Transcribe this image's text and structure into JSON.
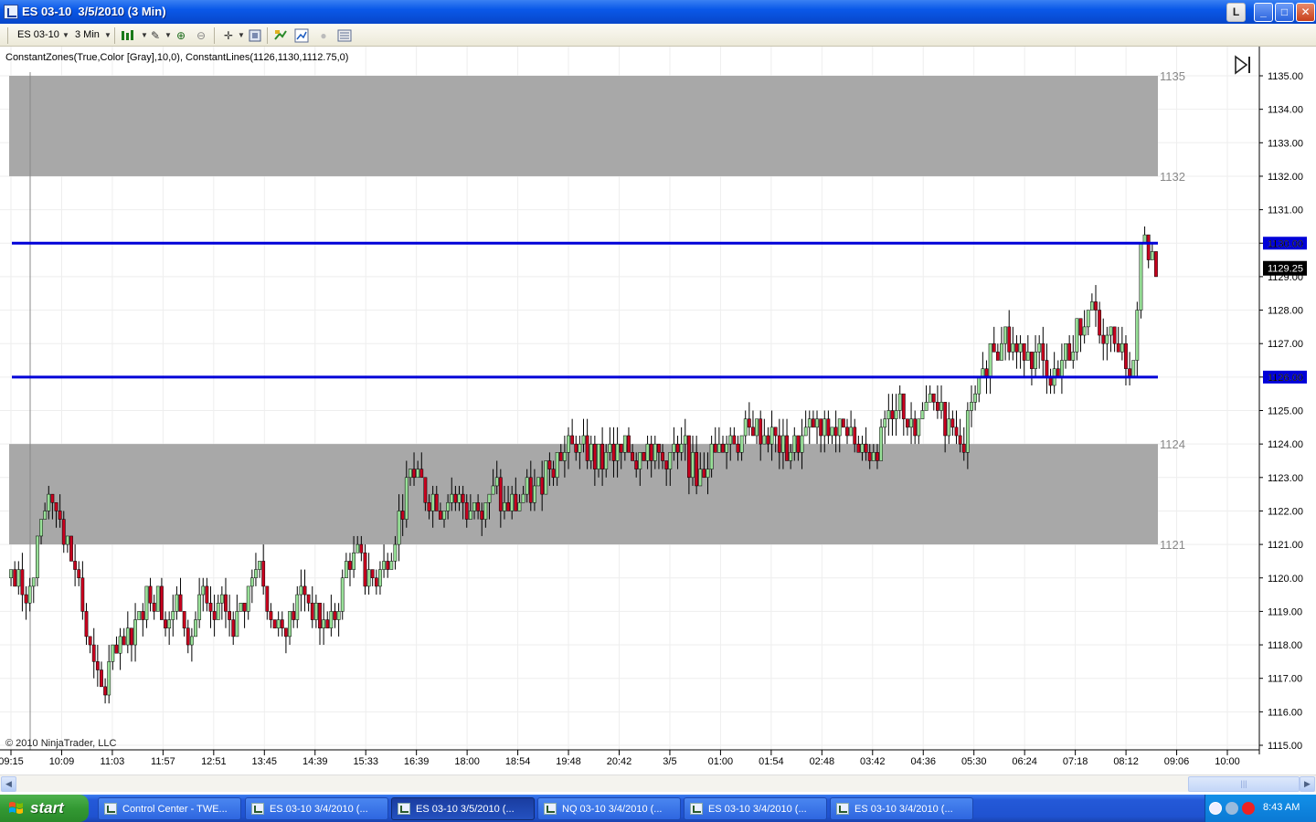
{
  "window": {
    "title": "ES 03-10  3/5/2010 (3 Min)",
    "buttons": {
      "l": "L",
      "minimize": "_",
      "maximize": "□",
      "close": "✕"
    }
  },
  "toolbar": {
    "instrument": "ES 03-10",
    "interval": "3 Min",
    "icons": [
      "dropdown-arrow-icon",
      "bar-chart-type-icon",
      "pencil-draw-icon",
      "zoom-in-icon",
      "zoom-out-icon",
      "crosshair-icon",
      "properties-icon",
      "strategy-icon",
      "indicator-icon",
      "globe-icon",
      "data-box-icon"
    ]
  },
  "chart": {
    "indicator_label": "ConstantZones(True,Color [Gray],10,0), ConstantLines(1126,1130,1112.75,0)",
    "copyright": "© 2010 NinjaTrader, LLC",
    "colors": {
      "up": "#98e098",
      "down": "#c8001e",
      "zone": "#a8a8a8",
      "line": "#0000d8"
    },
    "zones": [
      {
        "top": 1135,
        "bottom": 1132,
        "top_label": "1135",
        "bottom_label": "1132"
      },
      {
        "top": 1124,
        "bottom": 1121,
        "top_label": "1124",
        "bottom_label": "1121"
      }
    ],
    "lines": [
      {
        "value": 1130,
        "label": "1130.00"
      },
      {
        "value": 1126,
        "label": "1126.00"
      }
    ],
    "last_price": {
      "value": 1129.25,
      "label": "1129.25"
    },
    "y_axis_ticks": [
      "1135.00",
      "1134.00",
      "1133.00",
      "1132.00",
      "1131.00",
      "1130.00",
      "1129.00",
      "1128.00",
      "1127.00",
      "1126.00",
      "1125.00",
      "1124.00",
      "1123.00",
      "1122.00",
      "1121.00",
      "1120.00",
      "1119.00",
      "1118.00",
      "1117.00",
      "1116.00",
      "1115.00"
    ],
    "x_axis_ticks": [
      "09:15",
      "10:09",
      "11:03",
      "11:57",
      "12:51",
      "13:45",
      "14:39",
      "15:33",
      "16:39",
      "18:00",
      "18:54",
      "19:48",
      "20:42",
      "3/5",
      "01:00",
      "01:54",
      "02:48",
      "03:42",
      "04:36",
      "05:30",
      "06:24",
      "07:18",
      "08:12",
      "09:06",
      "10:00"
    ]
  },
  "chart_data": {
    "type": "candlestick",
    "title": "ES 03-10  3/5/2010 (3 Min)",
    "y_range": [
      1115,
      1135
    ],
    "x_ticks": [
      "09:15",
      "10:09",
      "11:03",
      "11:57",
      "12:51",
      "13:45",
      "14:39",
      "15:33",
      "16:39",
      "18:00",
      "18:54",
      "19:48",
      "20:42",
      "3/5",
      "01:00",
      "01:54",
      "02:48",
      "03:42",
      "04:36",
      "05:30",
      "06:24",
      "07:18",
      "08:12",
      "09:06",
      "10:00"
    ],
    "path": [
      [
        0,
        1120
      ],
      [
        3,
        1119.75
      ],
      [
        6,
        1120
      ],
      [
        9,
        1121.5
      ],
      [
        12,
        1122.75
      ],
      [
        15,
        1121
      ],
      [
        18,
        1120.25
      ],
      [
        21,
        1118
      ],
      [
        24,
        1116.5
      ],
      [
        27,
        1117.5
      ],
      [
        30,
        1117.75
      ],
      [
        33,
        1118.5
      ],
      [
        36,
        1119.5
      ],
      [
        39,
        1119.75
      ],
      [
        42,
        1118.75
      ],
      [
        45,
        1119.5
      ],
      [
        48,
        1118.25
      ],
      [
        51,
        1119.25
      ],
      [
        54,
        1118.75
      ],
      [
        57,
        1119.25
      ],
      [
        60,
        1118.5
      ],
      [
        63,
        1119.5
      ],
      [
        66,
        1120.5
      ],
      [
        69,
        1119.25
      ],
      [
        72,
        1118.25
      ],
      [
        75,
        1118.75
      ],
      [
        78,
        1119.75
      ],
      [
        81,
        1119
      ],
      [
        84,
        1118.5
      ],
      [
        87,
        1119.25
      ],
      [
        90,
        1120.5
      ],
      [
        93,
        1120.75
      ],
      [
        96,
        1119.75
      ],
      [
        99,
        1120.5
      ],
      [
        102,
        1121
      ],
      [
        105,
        1122.5
      ],
      [
        108,
        1123.25
      ],
      [
        111,
        1122.25
      ],
      [
        114,
        1122.5
      ],
      [
        117,
        1122
      ],
      [
        120,
        1122.25
      ],
      [
        123,
        1122
      ],
      [
        126,
        1122.25
      ],
      [
        129,
        1122.5
      ],
      [
        132,
        1122
      ],
      [
        135,
        1122.25
      ],
      [
        138,
        1122.5
      ],
      [
        141,
        1122.75
      ],
      [
        144,
        1123.75
      ],
      [
        147,
        1123.75
      ],
      [
        150,
        1124
      ],
      [
        153,
        1123.75
      ],
      [
        156,
        1123.5
      ],
      [
        159,
        1123.5
      ],
      [
        162,
        1123.75
      ],
      [
        165,
        1123.75
      ],
      [
        168,
        1124
      ],
      [
        171,
        1123.75
      ],
      [
        174,
        1123.5
      ],
      [
        177,
        1123.75
      ],
      [
        180,
        1123.5
      ],
      [
        183,
        1123
      ],
      [
        186,
        1123.75
      ],
      [
        189,
        1124
      ],
      [
        192,
        1124.25
      ],
      [
        195,
        1124.25
      ],
      [
        198,
        1124.5
      ],
      [
        201,
        1124.25
      ],
      [
        204,
        1124
      ],
      [
        207,
        1123.75
      ],
      [
        210,
        1124
      ],
      [
        213,
        1124.5
      ],
      [
        216,
        1124.25
      ],
      [
        219,
        1124.5
      ],
      [
        222,
        1124.25
      ],
      [
        225,
        1124
      ],
      [
        228,
        1123.75
      ],
      [
        231,
        1124
      ],
      [
        234,
        1125.25
      ],
      [
        237,
        1125
      ],
      [
        240,
        1124.75
      ],
      [
        243,
        1125
      ],
      [
        246,
        1125.25
      ],
      [
        249,
        1124.5
      ],
      [
        252,
        1124.25
      ],
      [
        255,
        1124.75
      ],
      [
        258,
        1125.75
      ],
      [
        261,
        1127
      ],
      [
        264,
        1127.25
      ],
      [
        267,
        1126.75
      ],
      [
        270,
        1127
      ],
      [
        273,
        1126.5
      ],
      [
        276,
        1126.25
      ],
      [
        279,
        1126.25
      ],
      [
        282,
        1127
      ],
      [
        285,
        1127.5
      ],
      [
        288,
        1127.75
      ],
      [
        291,
        1127.25
      ],
      [
        294,
        1126.75
      ],
      [
        297,
        1126.25
      ],
      [
        299,
        1126.5
      ],
      [
        300,
        1129
      ],
      [
        301,
        1130.75
      ],
      [
        302,
        1129.75
      ],
      [
        304,
        1129.25
      ]
    ]
  },
  "scrollbar": {
    "left_arrow": "◀",
    "right_arrow": "▶",
    "thumb_grip": "|||"
  },
  "taskbar": {
    "start": "start",
    "tasks": [
      {
        "label": "Control Center - TWE...",
        "active": false
      },
      {
        "label": "ES 03-10  3/4/2010 (...",
        "active": false
      },
      {
        "label": "ES 03-10  3/5/2010 (...",
        "active": true
      },
      {
        "label": "NQ 03-10  3/4/2010 (...",
        "active": false
      },
      {
        "label": "ES 03-10  3/4/2010 (...",
        "active": false
      },
      {
        "label": "ES 03-10  3/4/2010 (...",
        "active": false
      }
    ],
    "clock": "8:43 AM"
  }
}
